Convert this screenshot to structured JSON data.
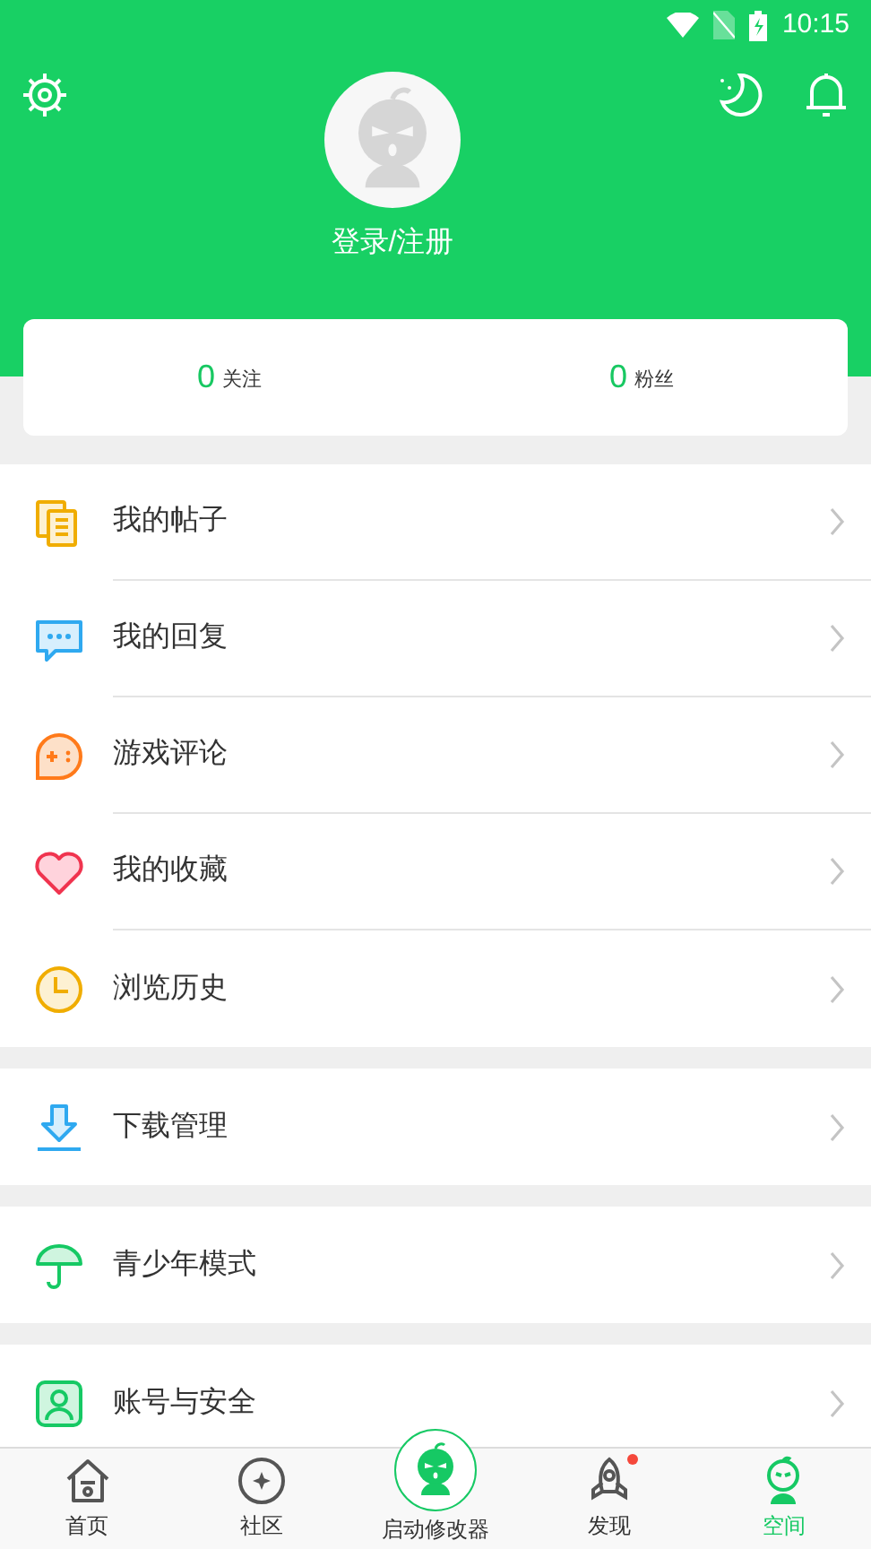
{
  "status_bar": {
    "time": "10:15"
  },
  "header": {
    "login_label": "登录/注册"
  },
  "stats": [
    {
      "count": "0",
      "label": "关注"
    },
    {
      "count": "0",
      "label": "粉丝"
    }
  ],
  "menu_groups": [
    {
      "items": [
        {
          "label": "我的帖子"
        },
        {
          "label": "我的回复"
        },
        {
          "label": "游戏评论"
        },
        {
          "label": "我的收藏"
        },
        {
          "label": "浏览历史"
        }
      ]
    },
    {
      "items": [
        {
          "label": "下载管理"
        }
      ]
    },
    {
      "items": [
        {
          "label": "青少年模式"
        }
      ]
    },
    {
      "items": [
        {
          "label": "账号与安全"
        }
      ]
    }
  ],
  "bottom_nav": [
    {
      "label": "首页",
      "kind": "tab",
      "selected": false,
      "badge": false
    },
    {
      "label": "社区",
      "kind": "tab",
      "selected": false,
      "badge": false
    },
    {
      "label": "启动修改器",
      "kind": "center",
      "selected": false,
      "badge": false
    },
    {
      "label": "发现",
      "kind": "tab",
      "selected": false,
      "badge": true
    },
    {
      "label": "空间",
      "kind": "tab",
      "selected": true,
      "badge": false
    }
  ]
}
